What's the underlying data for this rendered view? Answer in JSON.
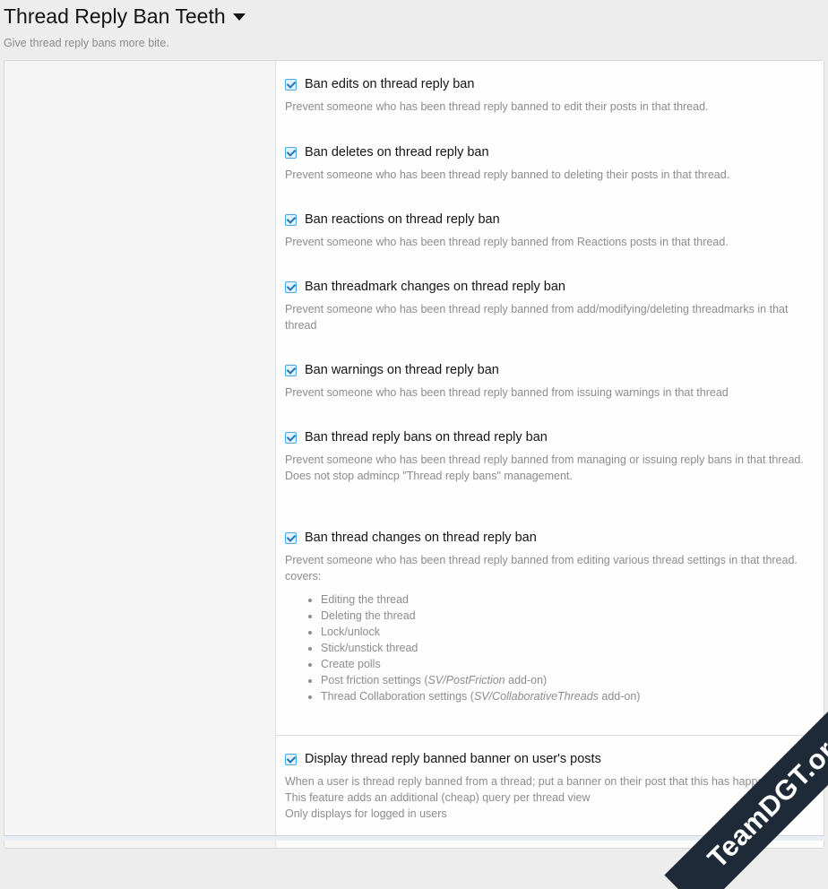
{
  "header": {
    "title": "Thread Reply Ban Teeth",
    "description": "Give thread reply bans more bite."
  },
  "options": [
    {
      "label": "Ban edits on thread reply ban",
      "checked": true,
      "hint": [
        "Prevent someone who has been thread reply banned to edit their posts in that thread."
      ]
    },
    {
      "label": "Ban deletes on thread reply ban",
      "checked": true,
      "hint": [
        "Prevent someone who has been thread reply banned to deleting their posts in that thread."
      ]
    },
    {
      "label": "Ban reactions on thread reply ban",
      "checked": true,
      "hint": [
        "Prevent someone who has been thread reply banned from Reactions posts in that thread."
      ]
    },
    {
      "label": "Ban threadmark changes on thread reply ban",
      "checked": true,
      "hint": [
        "Prevent someone who has been thread reply banned from add/modifying/deleting threadmarks in that thread"
      ]
    },
    {
      "label": "Ban warnings on thread reply ban",
      "checked": true,
      "hint": [
        "Prevent someone who has been thread reply banned from issuing warnings in that thread"
      ]
    },
    {
      "label": "Ban thread reply bans on thread reply ban",
      "checked": true,
      "hint": [
        "Prevent someone who has been thread reply banned from managing or issuing reply bans in that thread.",
        "Does not stop admincp \"Thread reply bans\" management."
      ]
    },
    {
      "label": "Ban thread changes on thread reply ban",
      "checked": true,
      "hint": [
        "Prevent someone who has been thread reply banned from editing various thread settings in that thread. covers:"
      ],
      "list": [
        {
          "text": "Editing the thread"
        },
        {
          "text": "Deleting the thread"
        },
        {
          "text": "Lock/unlock"
        },
        {
          "text": "Stick/unstick thread"
        },
        {
          "text": "Create polls"
        },
        {
          "pre": "Post friction settings (",
          "em": "SV/PostFriction",
          "post": " add-on)"
        },
        {
          "pre": "Thread Collaboration settings (",
          "em": "SV/CollaborativeThreads",
          "post": " add-on)"
        }
      ]
    },
    {
      "label": "Display thread reply banned banner on user's posts",
      "checked": true,
      "hint": [
        "When a user is thread reply banned from a thread; put a banner on their post that this has happened.",
        "This feature adds an additional (cheap) query per thread view",
        "Only displays for logged in users"
      ]
    }
  ],
  "watermark": {
    "text": "TeamDGT.org"
  }
}
